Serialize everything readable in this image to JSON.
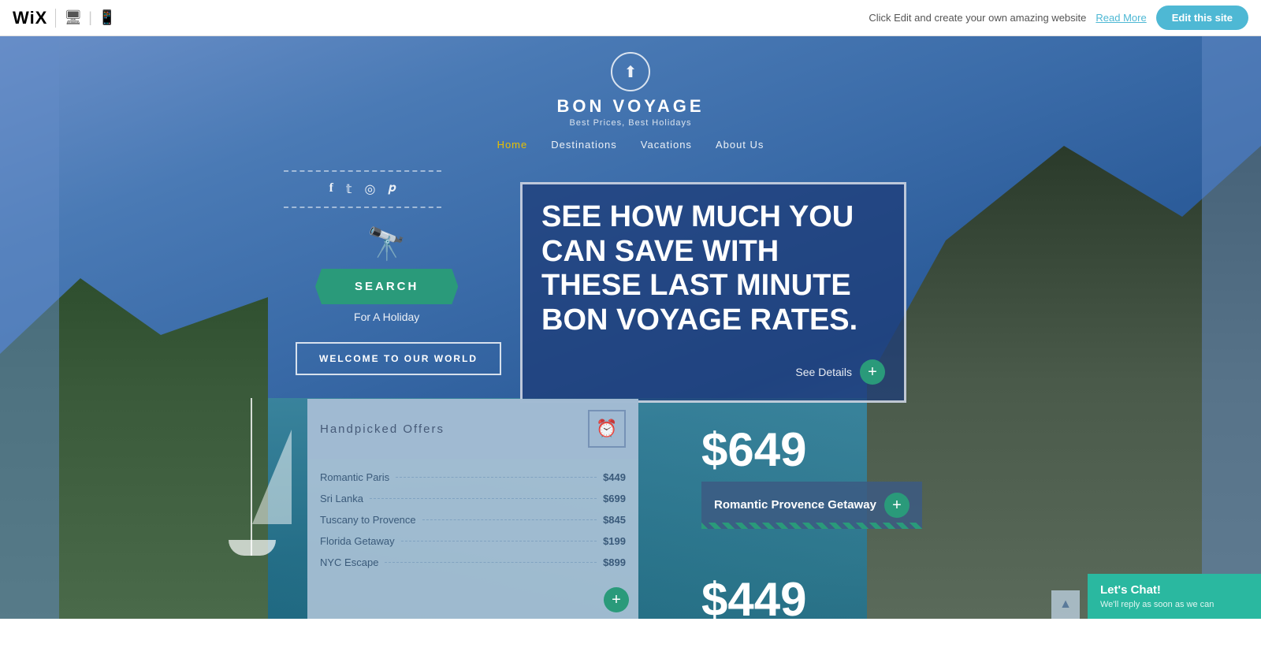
{
  "topbar": {
    "wix_logo": "WiX",
    "cta_text": "Click Edit and create your own amazing website",
    "read_more": "Read More",
    "edit_btn": "Edit this site",
    "desktop_icon": "🖥",
    "mobile_icon": "📱"
  },
  "brand": {
    "name": "BON VOYAGE",
    "tagline": "Best Prices, Best Holidays"
  },
  "nav": {
    "items": [
      {
        "label": "Home",
        "active": true
      },
      {
        "label": "Destinations",
        "active": false
      },
      {
        "label": "Vacations",
        "active": false
      },
      {
        "label": "About Us",
        "active": false
      }
    ]
  },
  "social": {
    "icons": [
      "f",
      "𝕥",
      "◎",
      "𝒑"
    ]
  },
  "search": {
    "btn_label": "SEARCH",
    "subtitle": "For A Holiday"
  },
  "welcome": {
    "btn_label": "WELCOME TO OUR WORLD"
  },
  "promo": {
    "text": "SEE HOW MUCH YOU CAN SAVE WITH THESE LAST MINUTE BON VOYAGE RATES.",
    "see_details": "See Details"
  },
  "offers": {
    "title": "Handpicked Offers",
    "items": [
      {
        "name": "Romantic Paris",
        "price": "$449"
      },
      {
        "name": "Sri Lanka",
        "price": "$699"
      },
      {
        "name": "Tuscany to Provence",
        "price": "$845"
      },
      {
        "name": "Florida Getaway",
        "price": "$199"
      },
      {
        "name": "NYC Escape",
        "price": "$899"
      }
    ]
  },
  "price1": "$649",
  "provence_card": {
    "title": "Romantic Provence Getaway"
  },
  "price2": "$449",
  "chat": {
    "title": "Let's Chat!",
    "subtitle": "We'll reply as soon as we can"
  }
}
